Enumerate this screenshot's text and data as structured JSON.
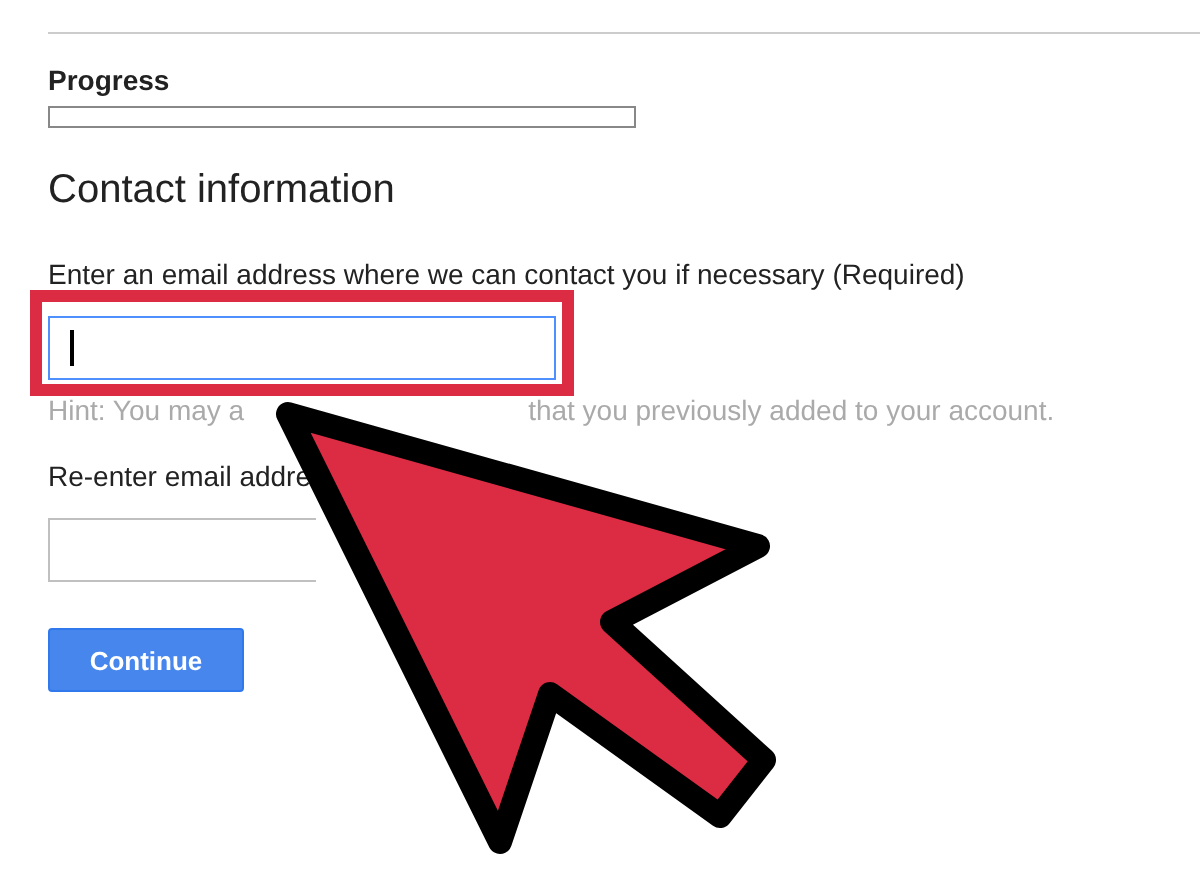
{
  "progress": {
    "label": "Progress"
  },
  "section": {
    "title": "Contact information"
  },
  "email": {
    "label": "Enter an email address where we can contact you if necessary (Required)",
    "focused": true,
    "highlighted": true
  },
  "hint": {
    "parts": [
      "Hint: You may a",
      "that you previously added to your account."
    ]
  },
  "reenter": {
    "label": "Re-enter email addre"
  },
  "buttons": [
    {
      "label": "Continue"
    }
  ],
  "overlay": {
    "kind": "pointer-arrow"
  }
}
